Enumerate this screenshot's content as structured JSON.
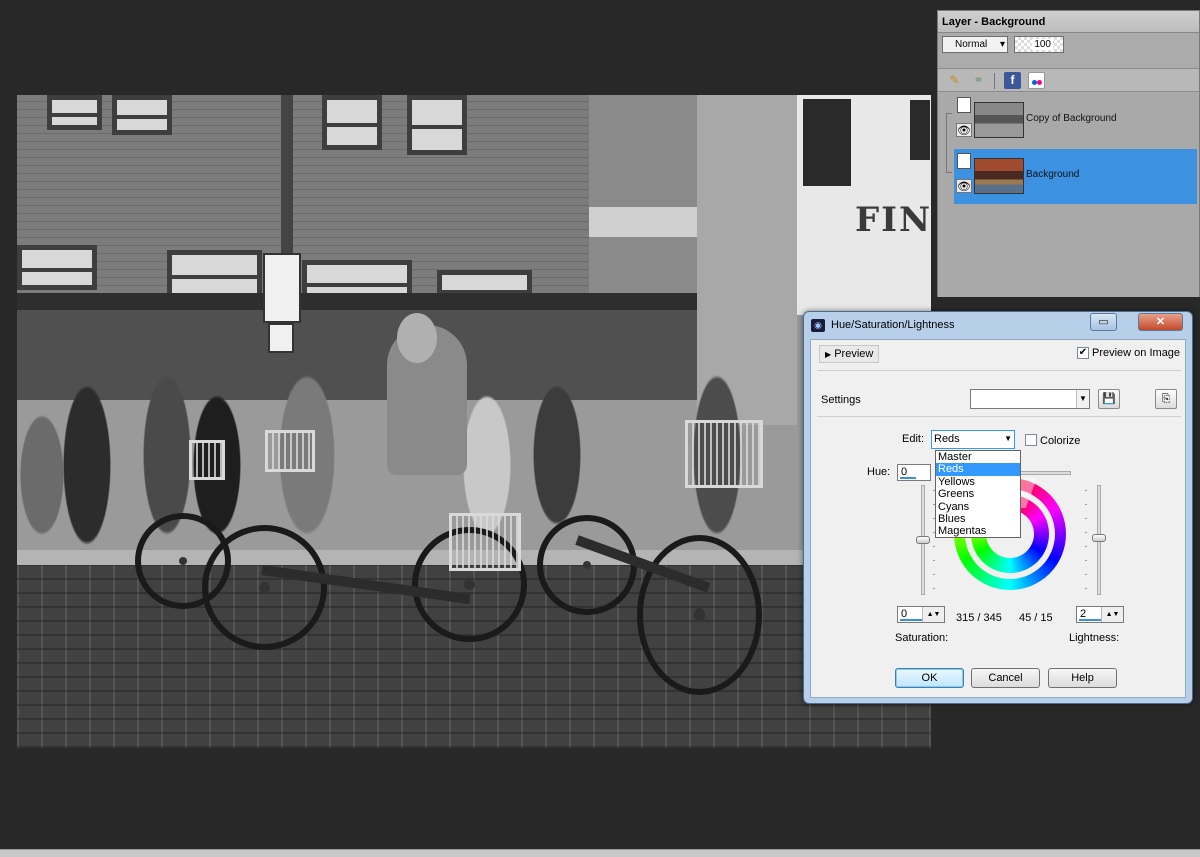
{
  "layer_panel": {
    "title": "Layer - Background",
    "blend_mode": "Normal",
    "opacity": "100",
    "layers": [
      {
        "name": "Copy of Background",
        "selected": false,
        "thumb": "grayscale"
      },
      {
        "name": "Background",
        "selected": true,
        "thumb": "color"
      }
    ],
    "toolbar_icons": [
      "brush-icon",
      "link-icon",
      "facebook-icon",
      "flickr-icon"
    ]
  },
  "canvas": {
    "sign_text": "FINC"
  },
  "dialog": {
    "title": "Hue/Saturation/Lightness",
    "preview_button": "Preview",
    "preview_on_image_label": "Preview on Image",
    "preview_on_image_checked": true,
    "settings_label": "Settings",
    "settings_value": "",
    "edit_label": "Edit:",
    "edit_value": "Reds",
    "colorize_label": "Colorize",
    "colorize_checked": false,
    "edit_options": [
      "Master",
      "Reds",
      "Yellows",
      "Greens",
      "Cyans",
      "Blues",
      "Magentas"
    ],
    "selected_option_index": 1,
    "hue_label": "Hue:",
    "hue_value": "0",
    "saturation_label": "Saturation:",
    "saturation_value": "0",
    "lightness_label": "Lightness:",
    "lightness_value": "2",
    "range_left": "315 / 345",
    "range_right": "45 / 15",
    "ok_label": "OK",
    "cancel_label": "Cancel",
    "help_label": "Help"
  },
  "colors": {
    "selection_blue": "#3c92e0",
    "dropdown_highlight": "#3399ff",
    "dialog_frame": "#b7cfe9",
    "workspace": "#282828"
  }
}
